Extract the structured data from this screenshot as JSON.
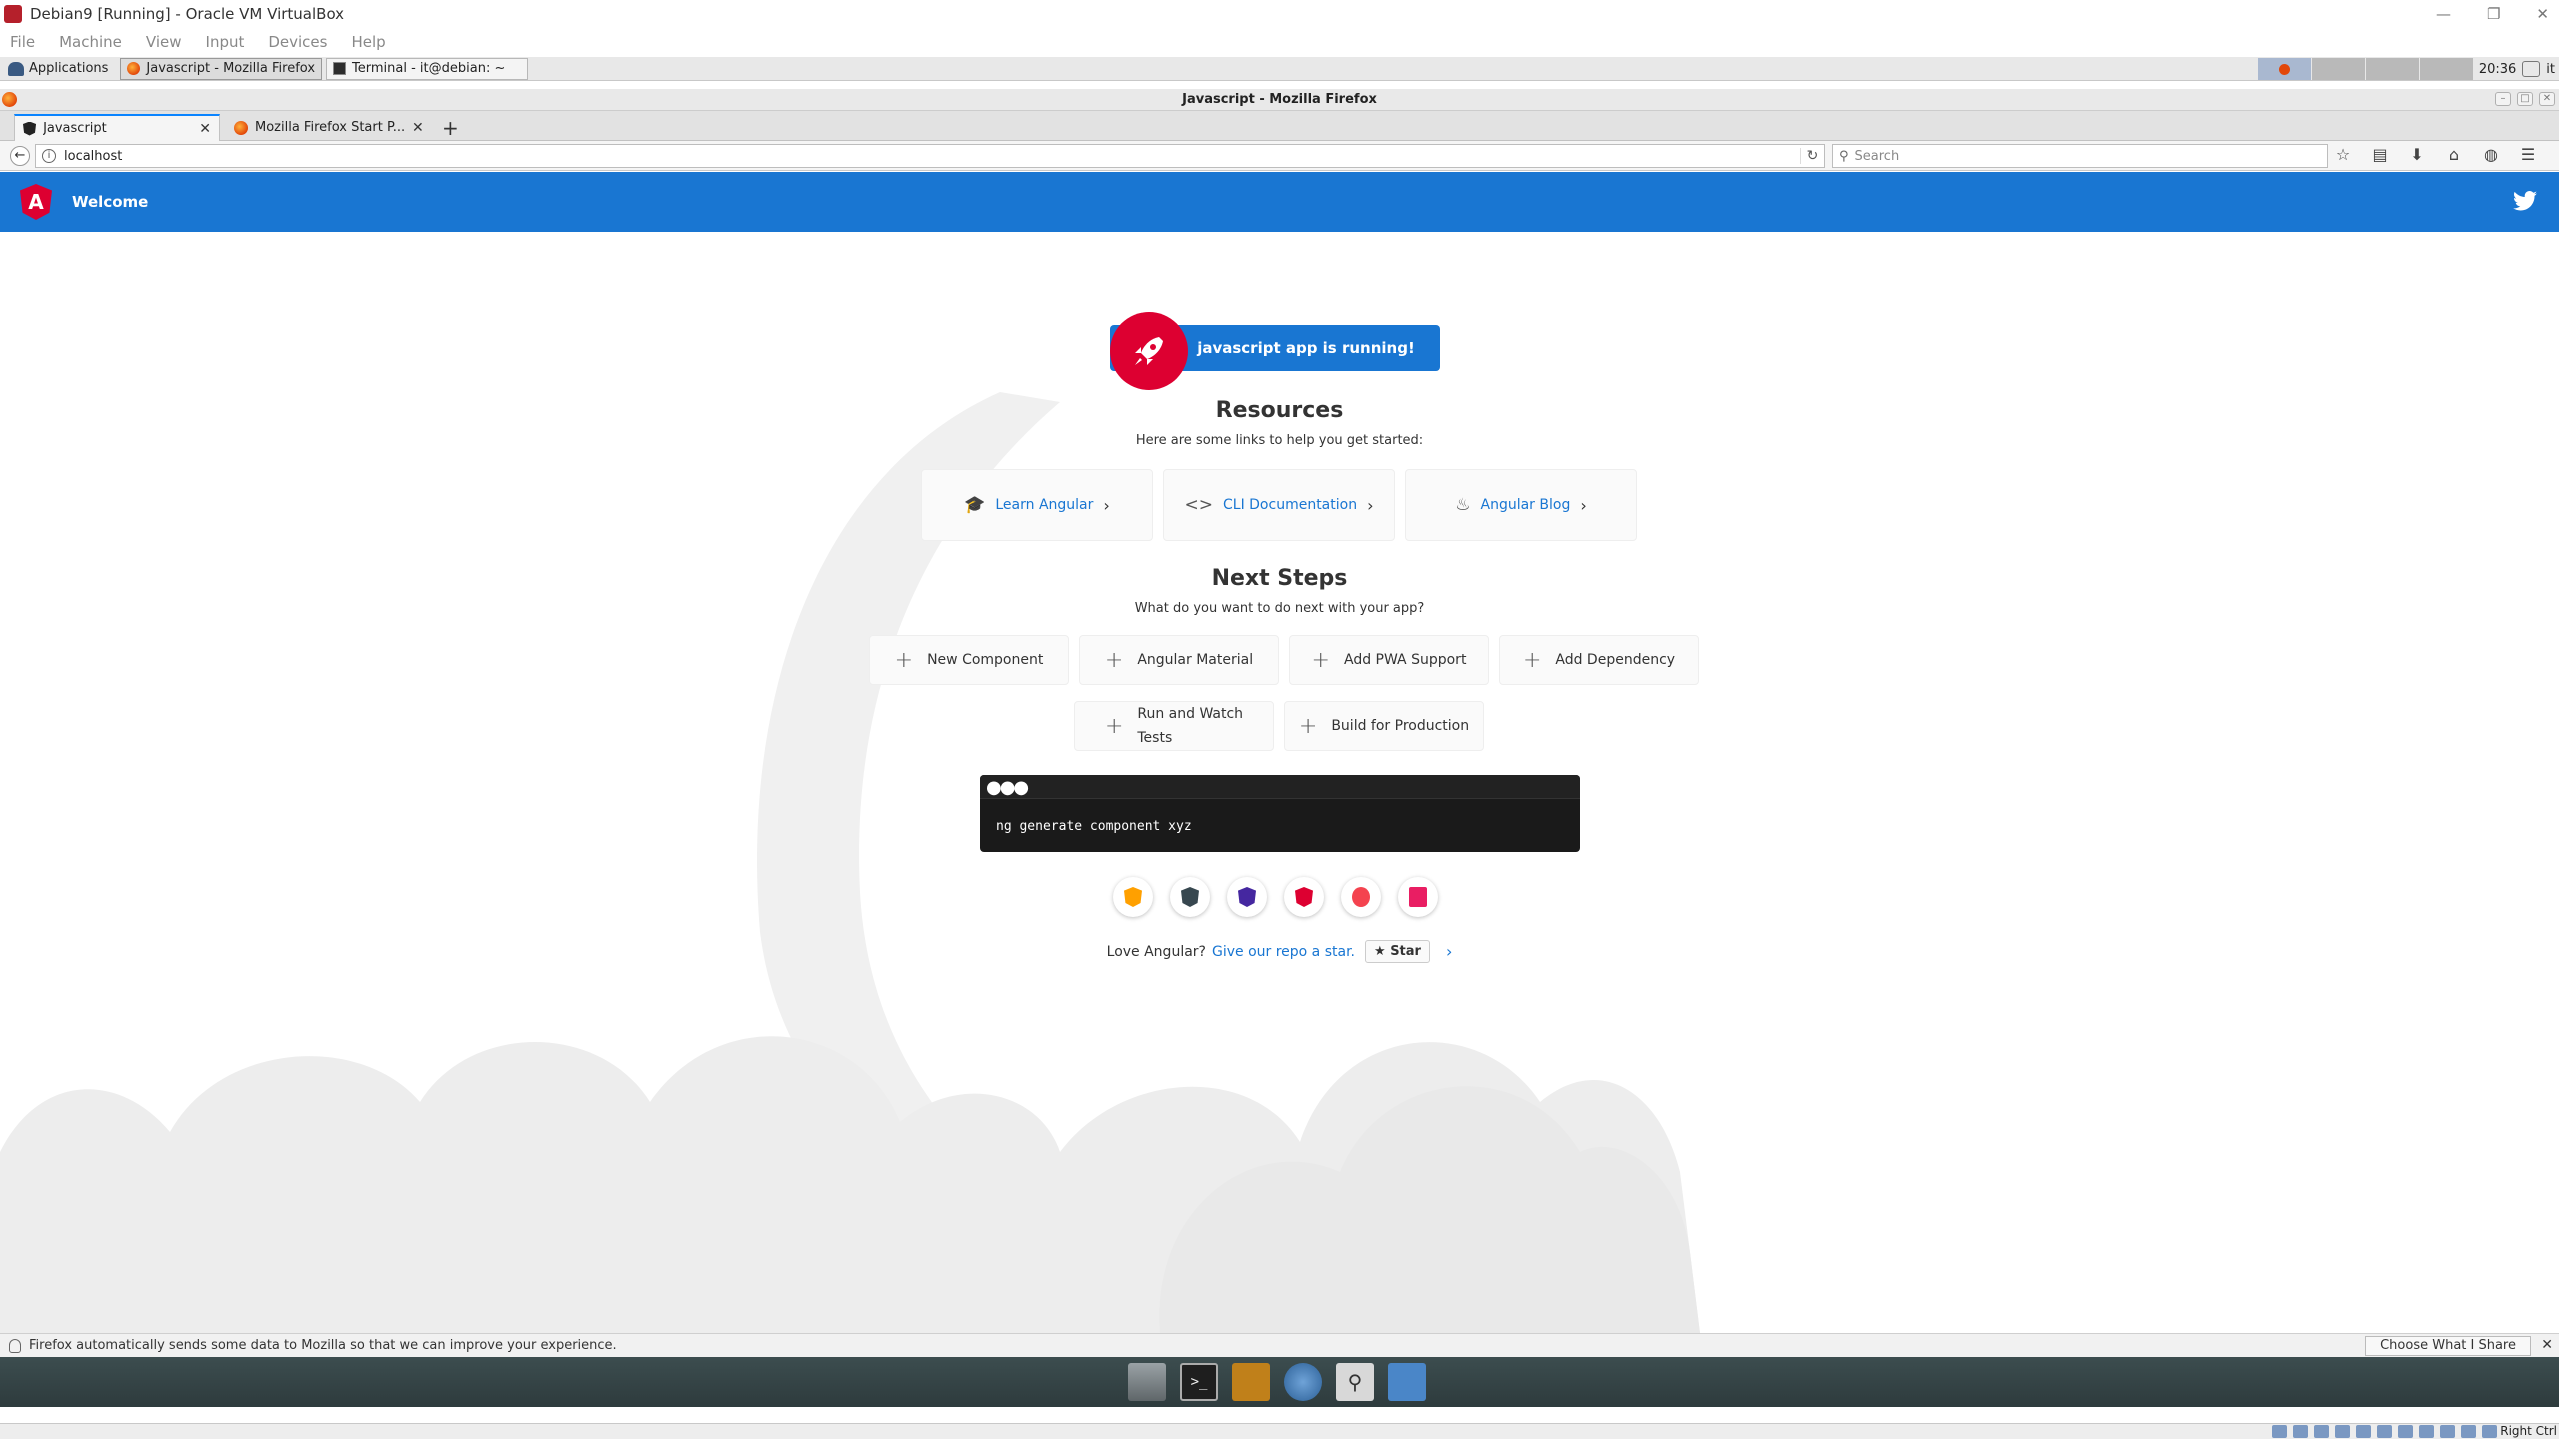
{
  "vbox": {
    "title": "Debian9 [Running] - Oracle VM VirtualBox",
    "menu": [
      "File",
      "Machine",
      "View",
      "Input",
      "Devices",
      "Help"
    ],
    "host_key": "Right Ctrl"
  },
  "panel": {
    "applications": "Applications",
    "tasks": [
      {
        "label": "Javascript - Mozilla Firefox",
        "icon": "firefox-icon",
        "active": true
      },
      {
        "label": "Terminal - it@debian: ~",
        "icon": "terminal-icon",
        "active": false
      }
    ],
    "clock": "20:36",
    "lang": "it"
  },
  "firefox": {
    "window_title": "Javascript - Mozilla Firefox",
    "tabs": [
      {
        "label": "Javascript",
        "icon": "angular-favicon"
      },
      {
        "label": "Mozilla Firefox Start P...",
        "icon": "firefox-favicon"
      }
    ],
    "url": "localhost",
    "search_placeholder": "Search",
    "notification": "Firefox automatically sends some data to Mozilla so that we can improve your experience.",
    "choose_btn": "Choose What I Share"
  },
  "app": {
    "toolbar_title": "Welcome",
    "running_text": "javascript app is running!",
    "resources_heading": "Resources",
    "resources_sub": "Here are some links to help you get started:",
    "resources": [
      {
        "label": "Learn Angular",
        "icon": "mortarboard-icon"
      },
      {
        "label": "CLI Documentation",
        "icon": "code-brackets-icon"
      },
      {
        "label": "Angular Blog",
        "icon": "flame-icon"
      }
    ],
    "next_heading": "Next Steps",
    "next_sub": "What do you want to do next with your app?",
    "steps_row1": [
      "New Component",
      "Angular Material",
      "Add PWA Support",
      "Add Dependency"
    ],
    "steps_row2_a1": "Run and Watch",
    "steps_row2_a2": "Tests",
    "steps_row2_b": "Build for Production",
    "terminal_cmd": "ng generate component xyz",
    "badges": [
      {
        "icon": "animations-icon",
        "color": "#ffa000"
      },
      {
        "icon": "cli-icon",
        "color": "#37474f"
      },
      {
        "icon": "augury-icon",
        "color": "#4527a0"
      },
      {
        "icon": "protractor-icon",
        "color": "#dd0031"
      },
      {
        "icon": "meetup-icon",
        "color": "#f4434f"
      },
      {
        "icon": "discord-icon",
        "color": "#e91e63"
      }
    ],
    "love_text": "Love Angular?",
    "star_link": "Give our repo a star.",
    "star_btn": "Star"
  },
  "colors": {
    "angular_blue": "#1976d2",
    "angular_red": "#dd0031"
  }
}
